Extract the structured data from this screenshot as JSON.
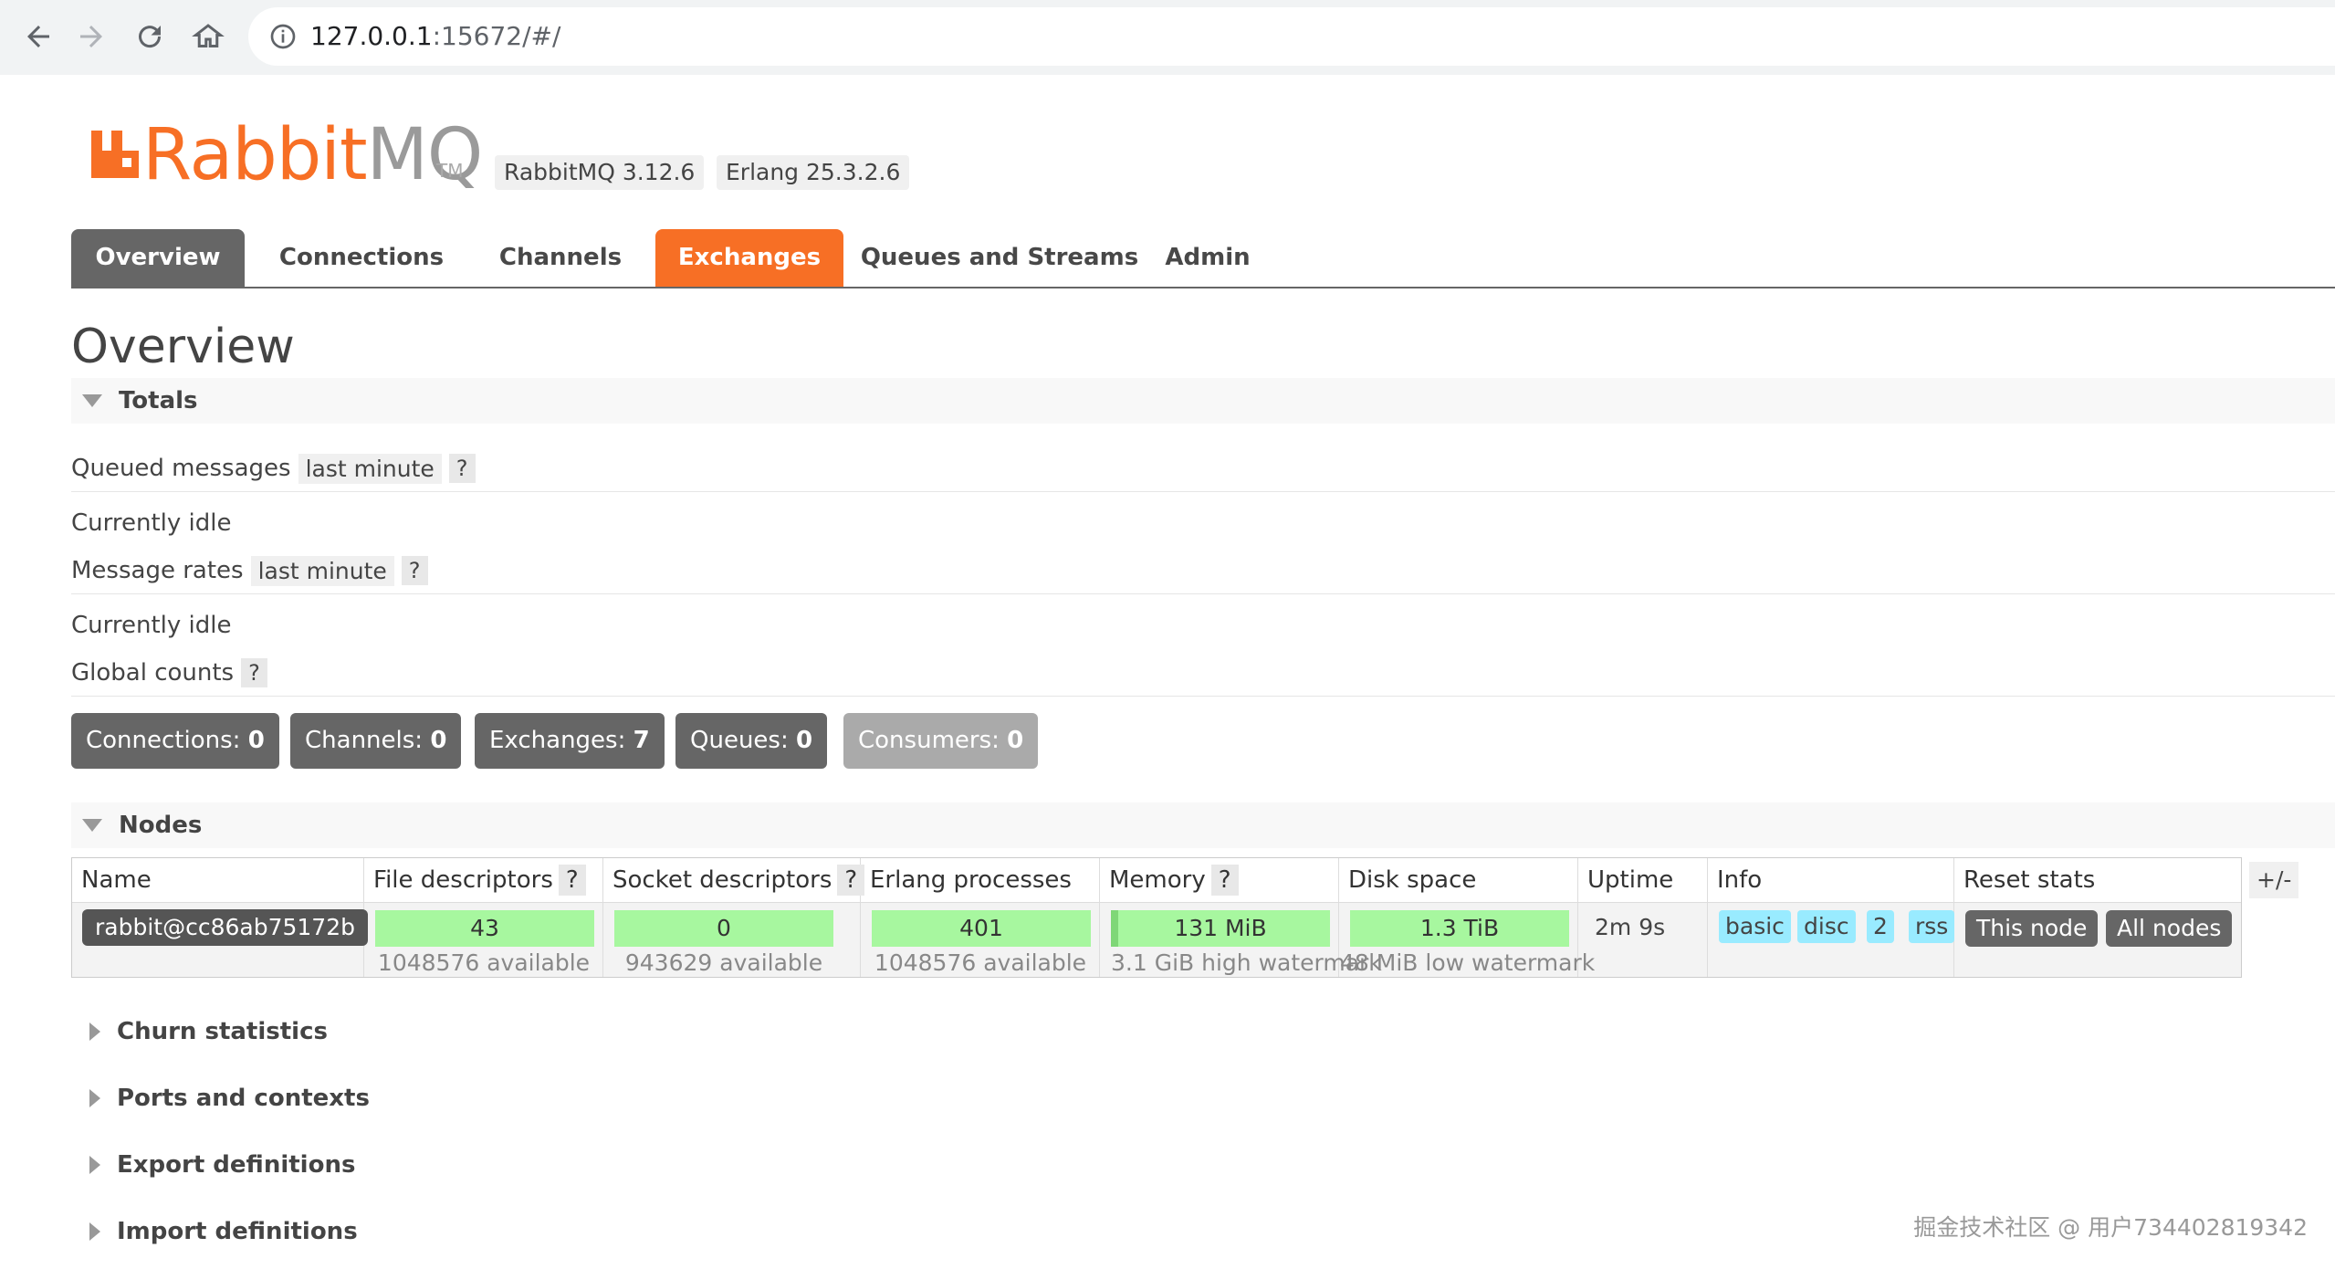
{
  "browser": {
    "url_host": "127.0.0.1",
    "url_rest": ":15672/#/"
  },
  "brand": {
    "logo_rabbit": "Rabbit",
    "logo_mq": "MQ",
    "logo_tm": "TM",
    "rabbitmq_version": "RabbitMQ 3.12.6",
    "erlang_version": "Erlang 25.3.2.6",
    "brand_color": "#f76f25"
  },
  "tabs": [
    {
      "label": "Overview",
      "state": "current"
    },
    {
      "label": "Connections"
    },
    {
      "label": "Channels"
    },
    {
      "label": "Exchanges",
      "state": "highlighted"
    },
    {
      "label": "Queues and Streams"
    },
    {
      "label": "Admin"
    }
  ],
  "page_title": "Overview",
  "totals": {
    "header": "Totals",
    "queued_messages": {
      "label": "Queued messages",
      "range": "last minute",
      "help": "?"
    },
    "queued_idle": "Currently idle",
    "message_rates": {
      "label": "Message rates",
      "range": "last minute",
      "help": "?"
    },
    "rates_idle": "Currently idle",
    "global_counts": {
      "label": "Global counts",
      "help": "?"
    },
    "counts": [
      {
        "label": "Connections:",
        "value": "0"
      },
      {
        "label": "Channels:",
        "value": "0"
      },
      {
        "label": "Exchanges:",
        "value": "7"
      },
      {
        "label": "Queues:",
        "value": "0"
      },
      {
        "label": "Consumers:",
        "value": "0"
      }
    ]
  },
  "nodes": {
    "header": "Nodes",
    "columns": {
      "name": "Name",
      "file_descriptors": "File descriptors",
      "socket_descriptors": "Socket descriptors",
      "erlang_processes": "Erlang processes",
      "memory": "Memory",
      "disk_space": "Disk space",
      "uptime": "Uptime",
      "info": "Info",
      "reset_stats": "Reset stats",
      "help": "?"
    },
    "toggle_columns": "+/-",
    "row": {
      "name": "rabbit@cc86ab75172b",
      "file_descriptors": {
        "value": "43",
        "sub": "1048576 available"
      },
      "socket_descriptors": {
        "value": "0",
        "sub": "943629 available"
      },
      "erlang_processes": {
        "value": "401",
        "sub": "1048576 available"
      },
      "memory": {
        "value": "131 MiB",
        "sub": "3.1 GiB high watermark"
      },
      "disk_space": {
        "value": "1.3 TiB",
        "sub": "48 MiB low watermark"
      },
      "uptime": "2m 9s",
      "info_tags": [
        "basic",
        "disc",
        "2",
        "rss"
      ],
      "reset_this_node": "This node",
      "reset_all_nodes": "All nodes"
    }
  },
  "collapsed_sections": [
    "Churn statistics",
    "Ports and contexts",
    "Export definitions",
    "Import definitions"
  ],
  "watermark": "掘金技术社区 @ 用户734402819342",
  "colors": {
    "ok_green": "#a7f79f",
    "info_blue": "#99ebff",
    "grey_button": "#666666"
  }
}
